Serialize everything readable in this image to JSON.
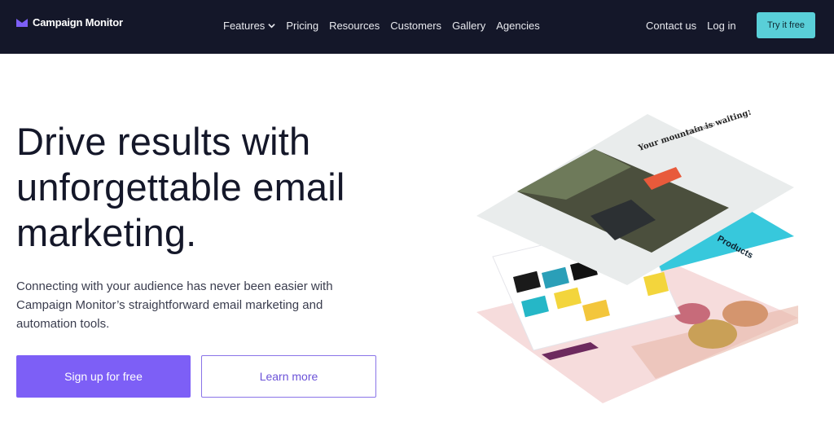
{
  "nav": {
    "brand": "Campaign Monitor",
    "menu": [
      {
        "label": "Features",
        "has_dropdown": true
      },
      {
        "label": "Pricing"
      },
      {
        "label": "Resources"
      },
      {
        "label": "Customers"
      },
      {
        "label": "Gallery"
      },
      {
        "label": "Agencies"
      }
    ],
    "right": [
      {
        "label": "Contact us"
      },
      {
        "label": "Log in"
      }
    ],
    "cta": "Try it free"
  },
  "hero": {
    "title": "Drive results with unforgettable email marketing.",
    "description": "Connecting with your audience has never been easier with Campaign Monitor’s straightforward email marketing and automation tools.",
    "primary_cta": "Sign up for free",
    "secondary_cta": "Learn more"
  },
  "illustration": {
    "top_card_heading": "Your mountain is waiting!",
    "top_card_brand": "GROUNDED",
    "products_label": "Products",
    "colors": {
      "nav_bg": "#141729",
      "accent_teal": "#59cfd8",
      "accent_purple": "#7d5ff6",
      "card_cyan": "#37c8dc",
      "card_pink": "#f4d6d6"
    }
  }
}
